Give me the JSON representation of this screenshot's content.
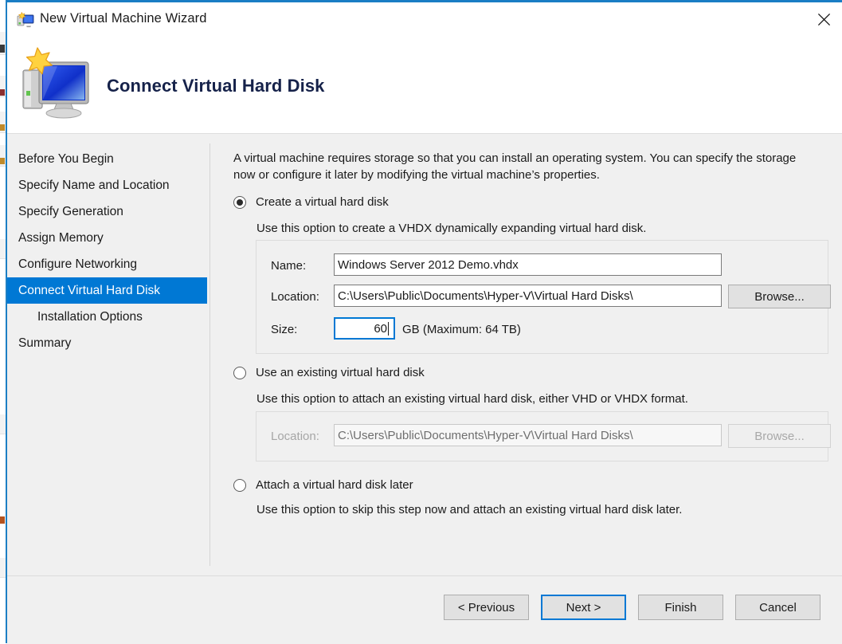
{
  "window": {
    "title": "New Virtual Machine Wizard",
    "title_icon": "new-vm-icon",
    "close_label": "Close",
    "accent_color": "#1a7dc4"
  },
  "banner": {
    "heading": "Connect Virtual Hard Disk",
    "icon": "computer-with-star-icon"
  },
  "sidebar": {
    "items": [
      {
        "label": "Before You Begin",
        "selected": false,
        "indented": false
      },
      {
        "label": "Specify Name and Location",
        "selected": false,
        "indented": false
      },
      {
        "label": "Specify Generation",
        "selected": false,
        "indented": false
      },
      {
        "label": "Assign Memory",
        "selected": false,
        "indented": false
      },
      {
        "label": "Configure Networking",
        "selected": false,
        "indented": false
      },
      {
        "label": "Connect Virtual Hard Disk",
        "selected": true,
        "indented": false
      },
      {
        "label": "Installation Options",
        "selected": false,
        "indented": true
      },
      {
        "label": "Summary",
        "selected": false,
        "indented": false
      }
    ],
    "selected_color": "#0078d4"
  },
  "main": {
    "intro": "A virtual machine requires storage so that you can install an operating system. You can specify the storage now or configure it later by modifying the virtual machine’s properties.",
    "options": [
      {
        "id": "create",
        "label": "Create a virtual hard disk",
        "selected": true,
        "description": "Use this option to create a VHDX dynamically expanding virtual hard disk.",
        "fields": {
          "name_label": "Name:",
          "name_value": "Windows Server 2012 Demo.vhdx",
          "location_label": "Location:",
          "location_value": "C:\\Users\\Public\\Documents\\Hyper-V\\Virtual Hard Disks\\",
          "browse_label": "Browse...",
          "size_label": "Size:",
          "size_value": "60",
          "size_suffix": "GB (Maximum: 64 TB)"
        }
      },
      {
        "id": "existing",
        "label": "Use an existing virtual hard disk",
        "selected": false,
        "description": "Use this option to attach an existing virtual hard disk, either VHD or VHDX format.",
        "fields": {
          "location_label": "Location:",
          "location_value": "C:\\Users\\Public\\Documents\\Hyper-V\\Virtual Hard Disks\\",
          "browse_label": "Browse...",
          "disabled": true
        }
      },
      {
        "id": "later",
        "label": "Attach a virtual hard disk later",
        "selected": false,
        "description": "Use this option to skip this step now and attach an existing virtual hard disk later."
      }
    ]
  },
  "footer": {
    "previous_label": "< Previous",
    "next_label": "Next >",
    "finish_label": "Finish",
    "cancel_label": "Cancel",
    "default_button": "next"
  }
}
